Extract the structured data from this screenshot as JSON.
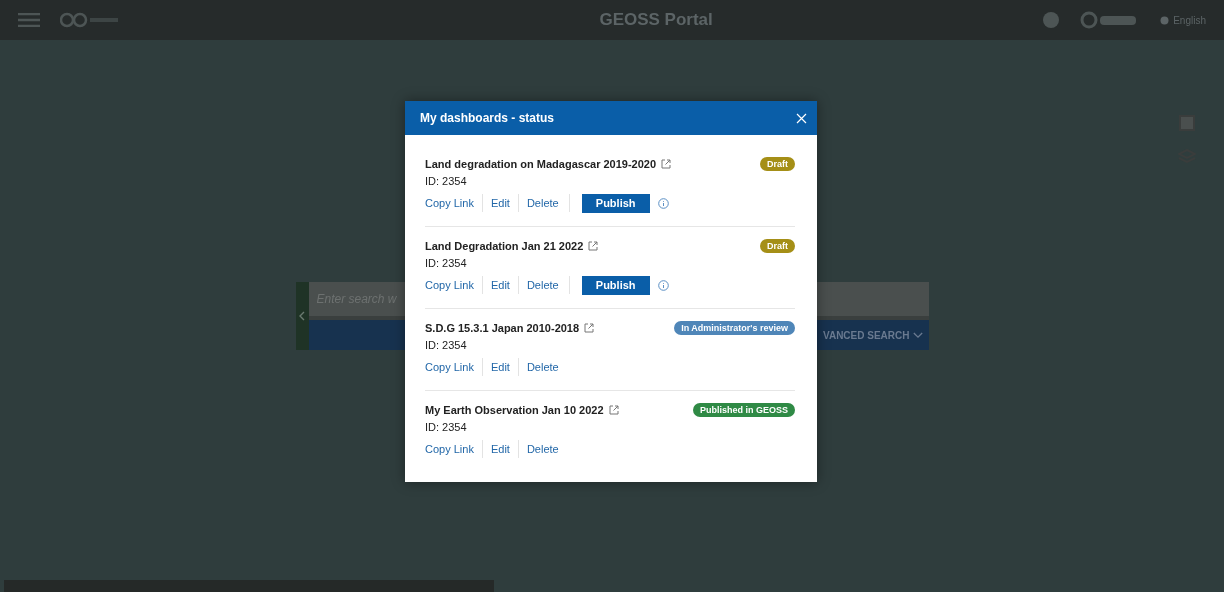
{
  "header": {
    "title": "GEOSS Portal",
    "language": "English"
  },
  "search": {
    "placeholder": "Enter search w",
    "button": "VANCED SEARCH"
  },
  "modal": {
    "title": "My dashboards - status",
    "items": [
      {
        "title": "Land degradation on Madagascar 2019-2020",
        "id": "ID: 2354",
        "status": {
          "label": "Draft",
          "color": "#a58f17"
        },
        "actions": [
          "Copy Link",
          "Edit",
          "Delete"
        ],
        "publish": "Publish"
      },
      {
        "title": "Land Degradation Jan 21 2022",
        "id": "ID: 2354",
        "status": {
          "label": "Draft",
          "color": "#a58f17"
        },
        "actions": [
          "Copy Link",
          "Edit",
          "Delete"
        ],
        "publish": "Publish"
      },
      {
        "title": "S.D.G 15.3.1 Japan 2010-2018",
        "id": "ID: 2354",
        "status": {
          "label": "In Administrator's review",
          "color": "#4f86b8"
        },
        "actions": [
          "Copy Link",
          "Edit",
          "Delete"
        ]
      },
      {
        "title": "My Earth Observation Jan 10 2022",
        "id": "ID: 2354",
        "status": {
          "label": "Published in GEOSS",
          "color": "#2f8a45"
        },
        "actions": [
          "Copy Link",
          "Edit",
          "Delete"
        ]
      }
    ]
  }
}
